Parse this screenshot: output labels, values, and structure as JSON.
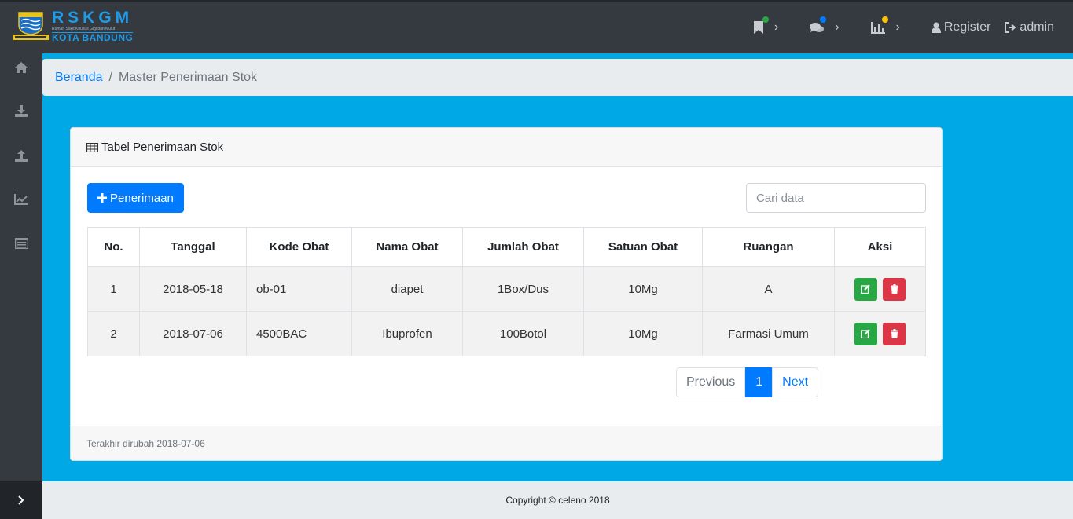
{
  "brand": {
    "title": "RSKGM",
    "subtitle": "Rumah Sakit Khusus Gigi dan Mulut",
    "city": "KOTA BANDUNG"
  },
  "navbar": {
    "register_label": "Register",
    "admin_label": "admin",
    "dot_colors": [
      "#28a745",
      "#007bff",
      "#ffc107"
    ]
  },
  "breadcrumb": {
    "home": "Beranda",
    "separator": "/",
    "current": "Master Penerimaan Stok"
  },
  "card": {
    "title": "Tabel Penerimaan Stok",
    "add_button": "Penerimaan",
    "search_placeholder": "Cari data",
    "footer": "Terakhir dirubah 2018-07-06"
  },
  "table": {
    "headers": [
      "No.",
      "Tanggal",
      "Kode Obat",
      "Nama Obat",
      "Jumlah Obat",
      "Satuan Obat",
      "Ruangan",
      "Aksi"
    ],
    "rows": [
      {
        "no": "1",
        "tanggal": "2018-05-18",
        "kode": "ob-01",
        "nama": "diapet",
        "jumlah": "1Box/Dus",
        "satuan": "10Mg",
        "ruangan": "A"
      },
      {
        "no": "2",
        "tanggal": "2018-07-06",
        "kode": "4500BAC",
        "nama": "Ibuprofen",
        "jumlah": "100Botol",
        "satuan": "10Mg",
        "ruangan": "Farmasi Umum"
      }
    ]
  },
  "pagination": {
    "previous": "Previous",
    "current": "1",
    "next": "Next"
  },
  "footer": {
    "copyright": "Copyright © celeno 2018"
  },
  "colors": {
    "accent": "#007bff",
    "background": "#00a8e6",
    "sidebar": "#343a40",
    "edit": "#28a745",
    "delete": "#dc3545"
  }
}
